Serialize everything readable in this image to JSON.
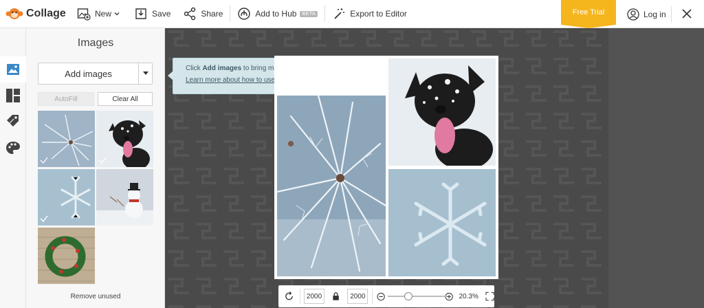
{
  "app": {
    "name": "Collage"
  },
  "toolbar": {
    "new_label": "New",
    "save_label": "Save",
    "share_label": "Share",
    "add_to_hub_label": "Add to Hub",
    "beta_badge": "BETA",
    "export_label": "Export to Editor",
    "free_trial_label": "Free Trial",
    "login_label": "Log in"
  },
  "sidebar": {
    "title": "Images",
    "add_images_label": "Add images",
    "autofill_label": "AutoFill",
    "clear_all_label": "Clear All",
    "remove_unused_label": "Remove unused",
    "thumbnails": [
      {
        "subject": "frosted pine needles",
        "used": true
      },
      {
        "subject": "dog with snow on face",
        "used": true
      },
      {
        "subject": "snowflake drawn in snow",
        "used": true
      },
      {
        "subject": "snowman",
        "used": false
      },
      {
        "subject": "christmas wreath on wood",
        "used": false
      }
    ]
  },
  "tooltip": {
    "prefix": "Click ",
    "bold": "Add images",
    "suffix": " to bring more pics into your project.",
    "link": "Learn more about how to use our Collage maker.",
    "close": "×"
  },
  "zoom": {
    "width_value": "2000",
    "height_value": "2000",
    "percent_label": "20.3%",
    "level": 0.35
  },
  "colors": {
    "accent": "#f5b51d",
    "canvas_bg": "#4a4a4a",
    "tooltip_bg": "#d4e6ea",
    "brand_orange": "#f0822b"
  }
}
